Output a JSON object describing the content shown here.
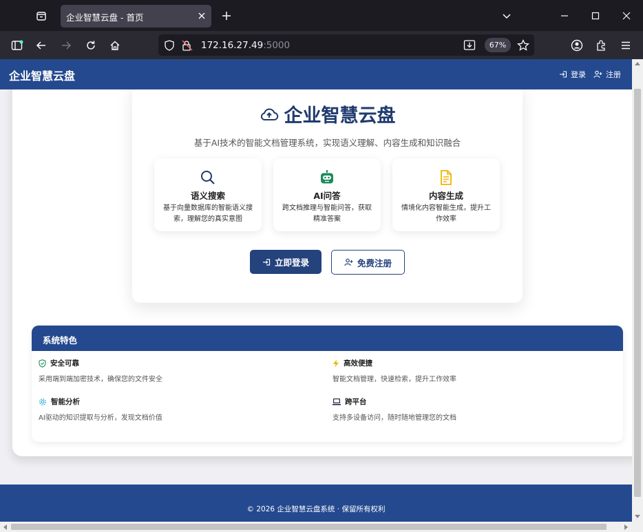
{
  "browser": {
    "tab_title": "企业智慧云盘 - 首页",
    "url_host": "172.16.27.49",
    "url_port": ":5000",
    "zoom": "67%"
  },
  "header": {
    "brand": "企业智慧云盘",
    "login": "登录",
    "register": "注册"
  },
  "hero": {
    "title": "企业智慧云盘",
    "subtitle": "基于AI技术的智能文档管理系统，实现语义理解、内容生成和知识融合",
    "features": [
      {
        "icon": "search-icon",
        "title": "语义搜索",
        "desc": "基于向量数据库的智能语义搜索，理解您的真实意图"
      },
      {
        "icon": "robot-icon",
        "title": "AI问答",
        "desc": "跨文档推理与智能问答，获取精准答案"
      },
      {
        "icon": "document-icon",
        "title": "内容生成",
        "desc": "情境化内容智能生成，提升工作效率"
      }
    ],
    "login_button": "立即登录",
    "register_button": "免费注册"
  },
  "system": {
    "title": "系统特色",
    "items": [
      {
        "icon": "shield-icon",
        "title": "安全可靠",
        "desc": "采用端到端加密技术，确保您的文件安全"
      },
      {
        "icon": "lightning-icon",
        "title": "高效便捷",
        "desc": "智能文档管理，快速检索，提升工作效率"
      },
      {
        "icon": "gear-icon",
        "title": "智能分析",
        "desc": "AI驱动的知识提取与分析，发现文档价值"
      },
      {
        "icon": "laptop-icon",
        "title": "跨平台",
        "desc": "支持多设备访问，随时随地管理您的文档"
      }
    ]
  },
  "footer": {
    "text": "© 2026 企业智慧云盘系统 · 保留所有权利"
  },
  "colors": {
    "primary": "#24498f",
    "button": "#24427c",
    "title": "#1f3a6e"
  }
}
